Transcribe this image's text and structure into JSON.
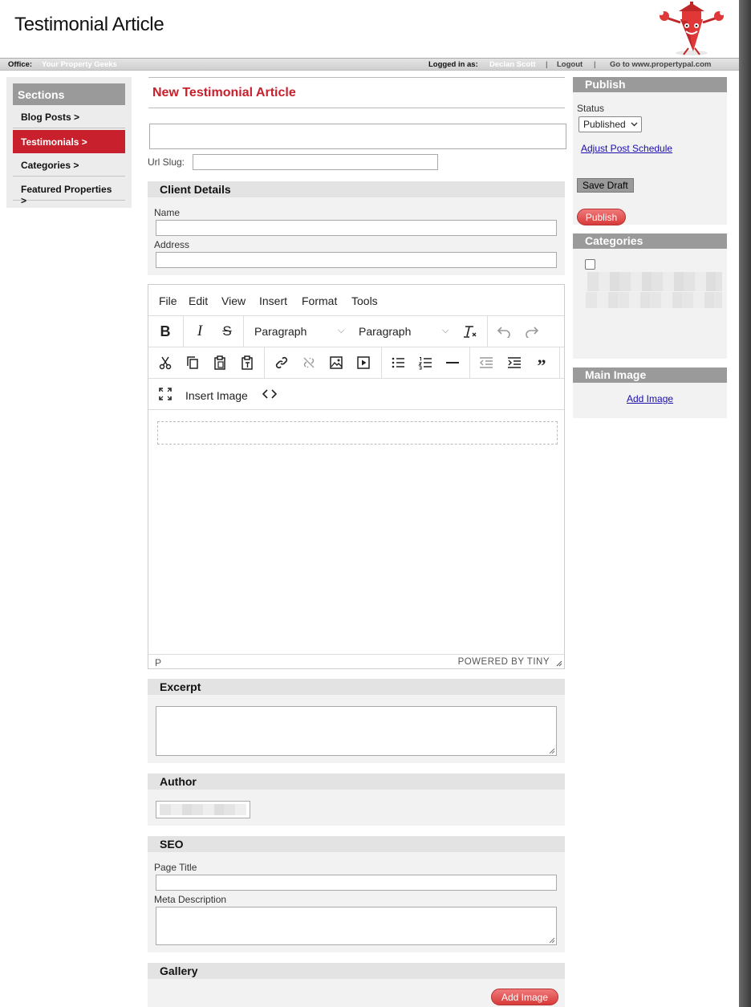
{
  "header": {
    "title": "Testimonial Article"
  },
  "topbar": {
    "office_label": "Office:",
    "office_name": "Your Property Geeks",
    "logged_label": "Logged in as:",
    "user_name": "Declan Scott",
    "sep1": "|",
    "logout": "Logout",
    "sep2": "|",
    "goto": "Go to www.propertypal.com"
  },
  "sidebar": {
    "heading": "Sections",
    "items": [
      {
        "label": "Blog Posts >"
      },
      {
        "label": "Testimonials >"
      },
      {
        "label": "Categories >"
      },
      {
        "label": "Featured Properties >"
      }
    ]
  },
  "main": {
    "title": "New Testimonial Article",
    "title_value": "",
    "url_slug_label": "Url Slug:",
    "url_slug_value": ""
  },
  "client_details": {
    "heading": "Client Details",
    "name_label": "Name",
    "address_label": "Address"
  },
  "editor": {
    "menu": [
      "File",
      "Edit",
      "View",
      "Insert",
      "Format",
      "Tools"
    ],
    "block_format_1": "Paragraph",
    "block_format_2": "Paragraph",
    "insert_image": "Insert Image",
    "status_path": "P",
    "powered_by": "POWERED BY TINY"
  },
  "excerpt": {
    "heading": "Excerpt"
  },
  "author": {
    "heading": "Author"
  },
  "seo": {
    "heading": "SEO",
    "page_title_label": "Page Title",
    "meta_description_label": "Meta Description"
  },
  "gallery": {
    "heading": "Gallery",
    "add_image": "Add Image"
  },
  "publish": {
    "heading": "Publish",
    "status_label": "Status",
    "status_value": "Published",
    "adjust_schedule": "Adjust Post Schedule",
    "save_draft": "Save Draft",
    "publish_button": "Publish"
  },
  "categories": {
    "heading": "Categories"
  },
  "main_image": {
    "heading": "Main Image",
    "add_image": "Add Image"
  },
  "colors": {
    "accent_red": "#c8202c",
    "panel_grey": "#9a9a9a",
    "panel_bg": "#f2f2f2"
  }
}
